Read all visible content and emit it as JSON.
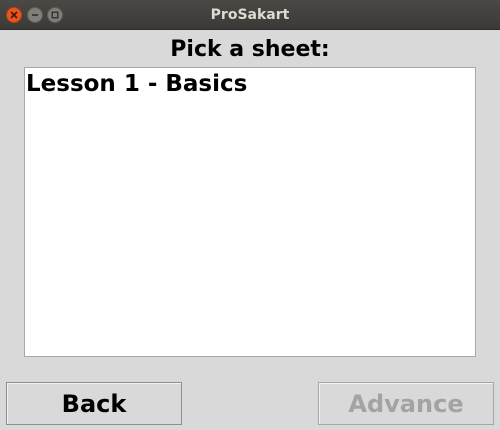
{
  "window": {
    "title": "ProSakart"
  },
  "heading": "Pick a sheet:",
  "sheet_list": {
    "items": [
      {
        "label": "Lesson 1 - Basics"
      }
    ]
  },
  "buttons": {
    "back_label": "Back",
    "advance_label": "Advance",
    "advance_enabled": false
  },
  "icons": {
    "close": "close-icon",
    "minimize": "minimize-icon",
    "maximize": "maximize-icon"
  },
  "colors": {
    "titlebar": "#3b3a37",
    "close_button": "#e9541f",
    "window_background": "#d9d9d9",
    "disabled_text": "#a3a3a3"
  }
}
